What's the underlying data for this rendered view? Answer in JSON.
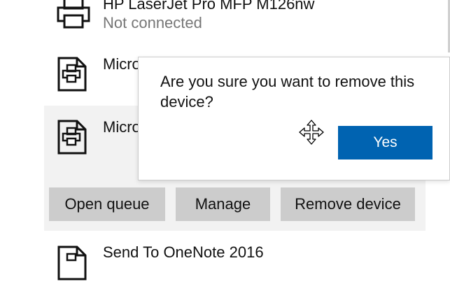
{
  "devices": [
    {
      "name": "HP LaserJet Pro MFP M126nw",
      "status": "Not connected",
      "icon": "printer-icon"
    },
    {
      "name": "Micro",
      "icon": "printer-document-icon"
    },
    {
      "name": "Micro",
      "icon": "printer-document-icon"
    },
    {
      "name": "Send To OneNote 2016",
      "icon": "printer-document-icon"
    }
  ],
  "actions": {
    "open_queue": "Open queue",
    "manage": "Manage",
    "remove_device": "Remove device"
  },
  "confirm_popup": {
    "message": "Are you sure you want to remove this device?",
    "yes_label": "Yes"
  },
  "cursor": "move-cursor-icon",
  "colors": {
    "accent": "#0063b1",
    "selected_background": "#f2f2f2",
    "button_background": "#cccccc",
    "secondary_text": "#767676"
  }
}
